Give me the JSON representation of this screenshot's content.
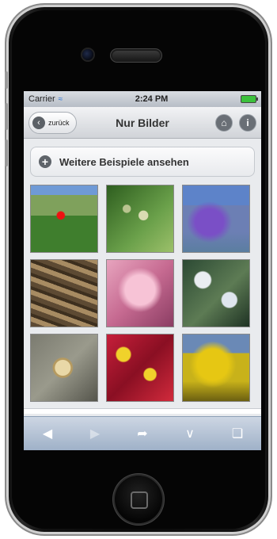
{
  "status": {
    "carrier": "Carrier",
    "time": "2:24 PM"
  },
  "header": {
    "back_label": "zurück",
    "title": "Nur Bilder"
  },
  "content": {
    "more_label": "Weitere Beispiele ansehen"
  },
  "images": [
    {
      "name": "image-1-poppy-meadow"
    },
    {
      "name": "image-2-poppy-seedheads"
    },
    {
      "name": "image-3-purple-flowers"
    },
    {
      "name": "image-4-rock-texture"
    },
    {
      "name": "image-5-pink-cherry-blossoms"
    },
    {
      "name": "image-6-white-blossoms"
    },
    {
      "name": "image-7-snail-shell"
    },
    {
      "name": "image-8-primrose-flowers"
    },
    {
      "name": "image-9-yellow-flowers"
    }
  ],
  "icons": {
    "back": "chevron-left-icon",
    "home": "home-icon",
    "info": "info-icon",
    "plus": "plus-icon",
    "toolbar": [
      "back-arrow-icon",
      "forward-arrow-icon",
      "share-icon",
      "bookmarks-icon",
      "tabs-icon"
    ]
  }
}
